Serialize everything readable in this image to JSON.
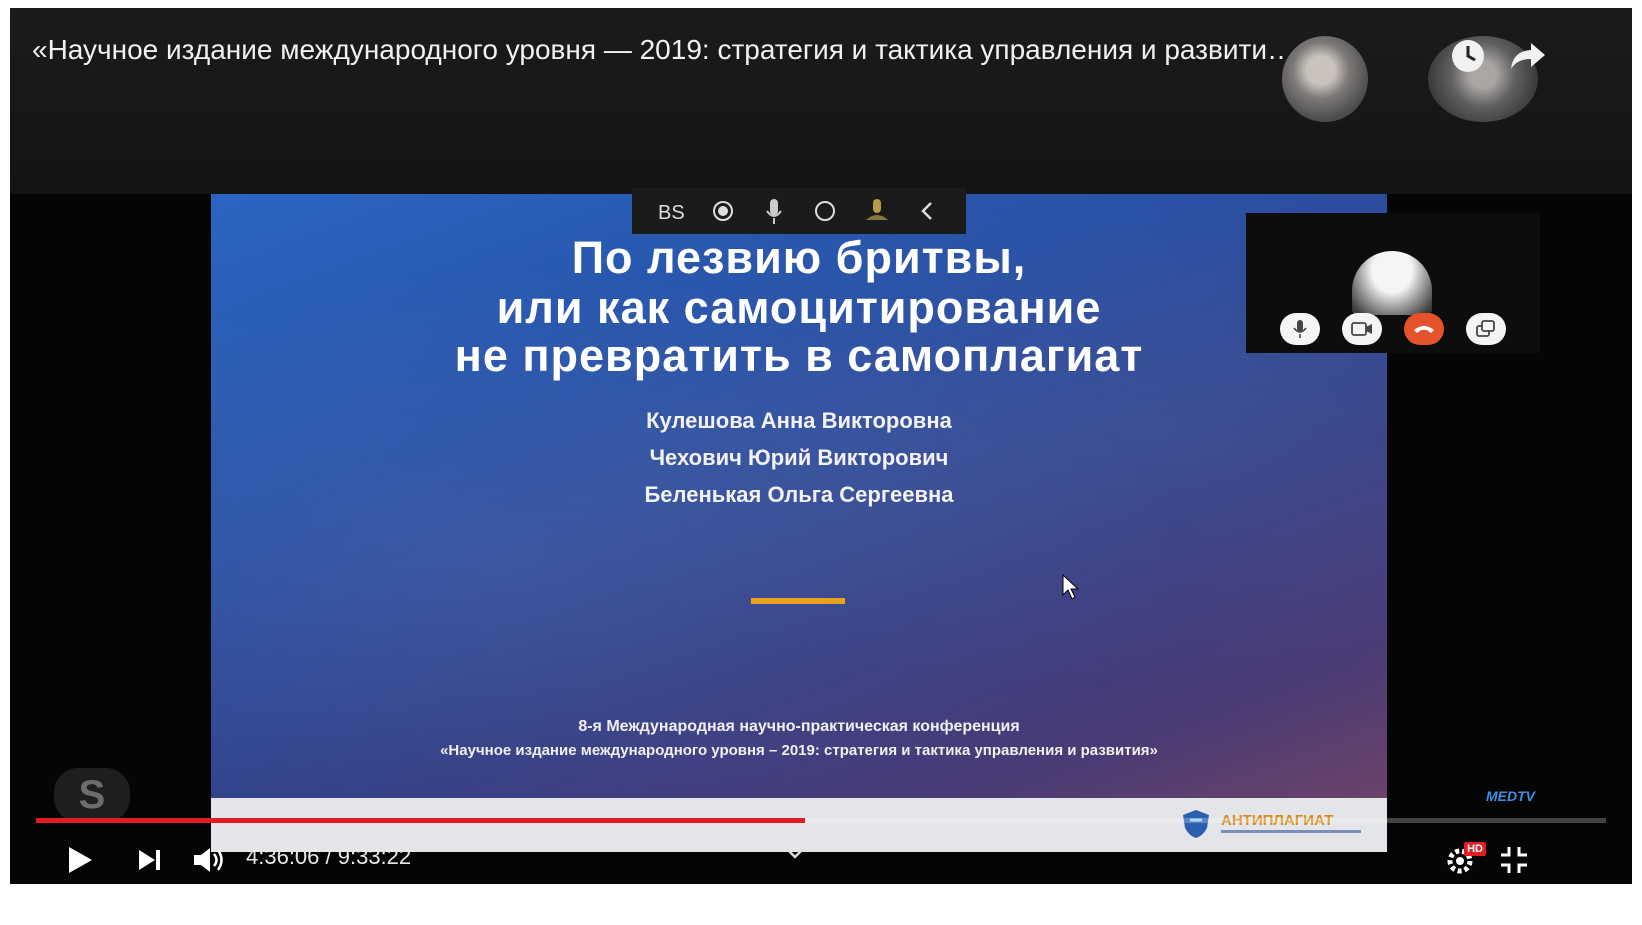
{
  "video": {
    "title": "«Научное издание международного уровня — 2019: стратегия и тактика управления и развити…",
    "time_display": "4:36:06 / 9:33:22",
    "progress_percent": 49,
    "quality_badge": "HD"
  },
  "slide": {
    "title_lines": [
      "По лезвию бритвы,",
      "или как самоцитирование",
      "не превратить в самоплагиат"
    ],
    "authors": [
      "Кулешова Анна Викторовна",
      "Чехович Юрий Викторович",
      "Беленькая Ольга Сергеевна"
    ],
    "conference_line1": "8-я Международная научно-практическая конференция",
    "conference_line2": "«Научное издание международного уровня – 2019: стратегия и тактика управления и развития»",
    "footer_logo": "АНТИПЛАГИАТ"
  },
  "watermark": {
    "channel": "MEDTV"
  },
  "colors": {
    "progress": "#e31b23",
    "accent": "#e8a21f",
    "end_call": "#e4532c",
    "slide_blue": "#2a66c4"
  },
  "icons": [
    "watch-later-icon",
    "share-icon",
    "play-icon",
    "next-icon",
    "volume-icon",
    "settings-icon",
    "exit-fullscreen-icon",
    "chevron-down-icon",
    "mic-icon",
    "camera-icon",
    "end-call-icon",
    "screen-share-icon",
    "skype-logo-icon",
    "pointer-cursor-icon"
  ]
}
